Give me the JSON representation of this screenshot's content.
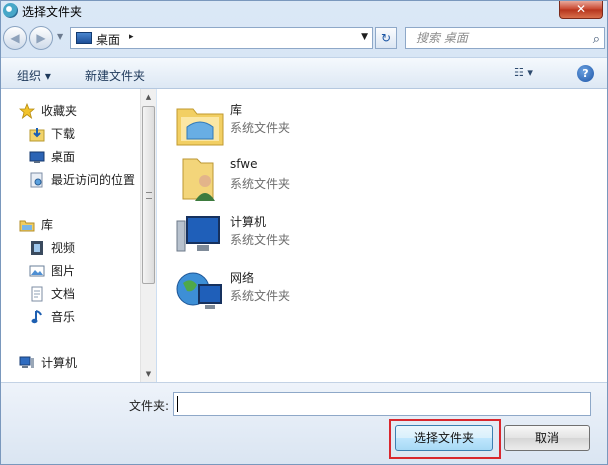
{
  "window": {
    "title": "选择文件夹",
    "close_label": "✕"
  },
  "nav": {
    "back_glyph": "◀",
    "forward_glyph": "▶",
    "dropdown_glyph": "▼"
  },
  "address": {
    "location": "桌面",
    "separator": "▸",
    "dropdown_glyph": "▼",
    "refresh_glyph": "↻"
  },
  "search": {
    "placeholder": "搜索 桌面",
    "icon": "search-icon"
  },
  "toolbar": {
    "organize_label": "组织 ▾",
    "new_folder_label": "新建文件夹",
    "view_label": "☷ ▾",
    "help_label": "?"
  },
  "sidebar": {
    "items": [
      {
        "label": "收藏夹",
        "icon": "star-icon"
      },
      {
        "label": "下载",
        "icon": "download-icon"
      },
      {
        "label": "桌面",
        "icon": "desktop-icon"
      },
      {
        "label": "最近访问的位置",
        "icon": "recent-places-icon"
      },
      {
        "label": "库",
        "icon": "library-icon"
      },
      {
        "label": "视频",
        "icon": "video-icon"
      },
      {
        "label": "图片",
        "icon": "picture-icon"
      },
      {
        "label": "文档",
        "icon": "document-icon"
      },
      {
        "label": "音乐",
        "icon": "music-icon"
      },
      {
        "label": "计算机",
        "icon": "computer-icon"
      }
    ]
  },
  "content": {
    "items": [
      {
        "name": "库",
        "type": "系统文件夹",
        "icon": "library-folder-icon"
      },
      {
        "name": "sfwe",
        "type": "系统文件夹",
        "icon": "user-folder-icon"
      },
      {
        "name": "计算机",
        "type": "系统文件夹",
        "icon": "computer-icon"
      },
      {
        "name": "网络",
        "type": "系统文件夹",
        "icon": "network-icon"
      }
    ]
  },
  "footer": {
    "folder_label": "文件夹:",
    "folder_value": "",
    "select_button": "选择文件夹",
    "cancel_button": "取消"
  },
  "colors": {
    "highlight": "#d9272e",
    "window_frame": "#c5d9ef"
  }
}
